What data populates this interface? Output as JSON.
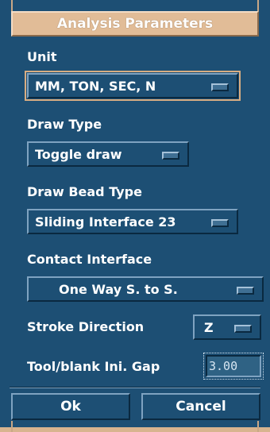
{
  "dialog": {
    "title": "Analysis Parameters",
    "accent": "#e1bc97",
    "background": "#1d4f74"
  },
  "fields": {
    "unit": {
      "label": "Unit",
      "value": "MM, TON, SEC, N"
    },
    "draw_type": {
      "label": "Draw Type",
      "value": "Toggle draw"
    },
    "draw_bead_type": {
      "label": "Draw Bead Type",
      "value": "Sliding Interface 23"
    },
    "contact_interface": {
      "label": "Contact Interface",
      "value": "One Way S. to S."
    },
    "stroke_direction": {
      "label": "Stroke Direction",
      "value": "Z"
    },
    "gap": {
      "label": "Tool/blank Ini. Gap",
      "value": "3.00"
    }
  },
  "buttons": {
    "ok": "Ok",
    "cancel": "Cancel"
  }
}
